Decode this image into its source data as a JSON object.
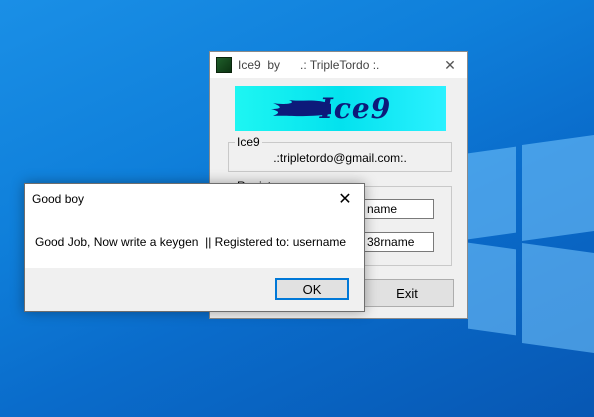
{
  "main_window": {
    "title": "Ice9  by      .: TripleTordo :.",
    "close_glyph": "✕",
    "logo_text": "Ice9",
    "ice9_group": {
      "label": "Ice9",
      "email": ".:tripletordo@gmail.com:."
    },
    "register_group": {
      "label": "Register",
      "name_value": "name",
      "serial_value": "38rname"
    },
    "exit_label": "Exit"
  },
  "dialog": {
    "title": "Good boy",
    "close_glyph": "✕",
    "message": "Good Job, Now write a keygen  || Registered to: username",
    "ok_label": "OK"
  },
  "colors": {
    "desktop_blue": "#0f7fda",
    "logo_cyan": "#03e2ee",
    "logo_text_navy": "#0d1a7a",
    "focus_blue": "#0078d7"
  }
}
